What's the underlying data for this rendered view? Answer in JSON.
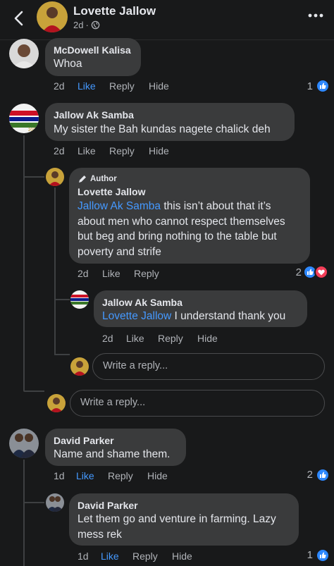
{
  "header": {
    "name": "Lovette Jallow",
    "time": "2d",
    "separator": "·"
  },
  "actions": {
    "like": "Like",
    "reply": "Reply",
    "hide": "Hide"
  },
  "reply_placeholder": "Write a reply...",
  "comments": [
    {
      "author": "McDowell Kalisa",
      "text": "Whoa",
      "time": "2d",
      "liked": true,
      "reactions": "1"
    },
    {
      "author": "Jallow Ak Samba",
      "text": "My sister the Bah kundas nagete chalick deh",
      "time": "2d",
      "liked": false
    },
    {
      "badge": "Author",
      "author": "Lovette Jallow",
      "mention": "Jallow Ak Samba",
      "lines": [
        " this isn’t about that it’s",
        "about men who cannot respect themselves",
        "but beg and bring nothing to the table but",
        "poverty and strife"
      ],
      "time": "2d",
      "liked": false,
      "reactions": "2"
    },
    {
      "author": "Jallow Ak Samba",
      "mention": "Lovette Jallow",
      "text": " I understand thank you",
      "time": "2d",
      "liked": false
    },
    {
      "author": "David Parker",
      "text": "Name and shame them.",
      "time": "1d",
      "liked": true,
      "reactions": "2"
    },
    {
      "author": "David Parker",
      "lines": [
        "Let them go and venture in farming. Lazy",
        "mess rek"
      ],
      "time": "1d",
      "liked": true,
      "reactions": "1"
    }
  ],
  "colors": {
    "background": "#18191a",
    "bubble": "#3a3b3c",
    "accent": "#4599ff",
    "like": "#2d88ff",
    "love": "#f33e58"
  },
  "icons": [
    "back-arrow-icon",
    "globe-icon",
    "more-icon",
    "pencil-icon",
    "like-icon",
    "heart-icon"
  ]
}
